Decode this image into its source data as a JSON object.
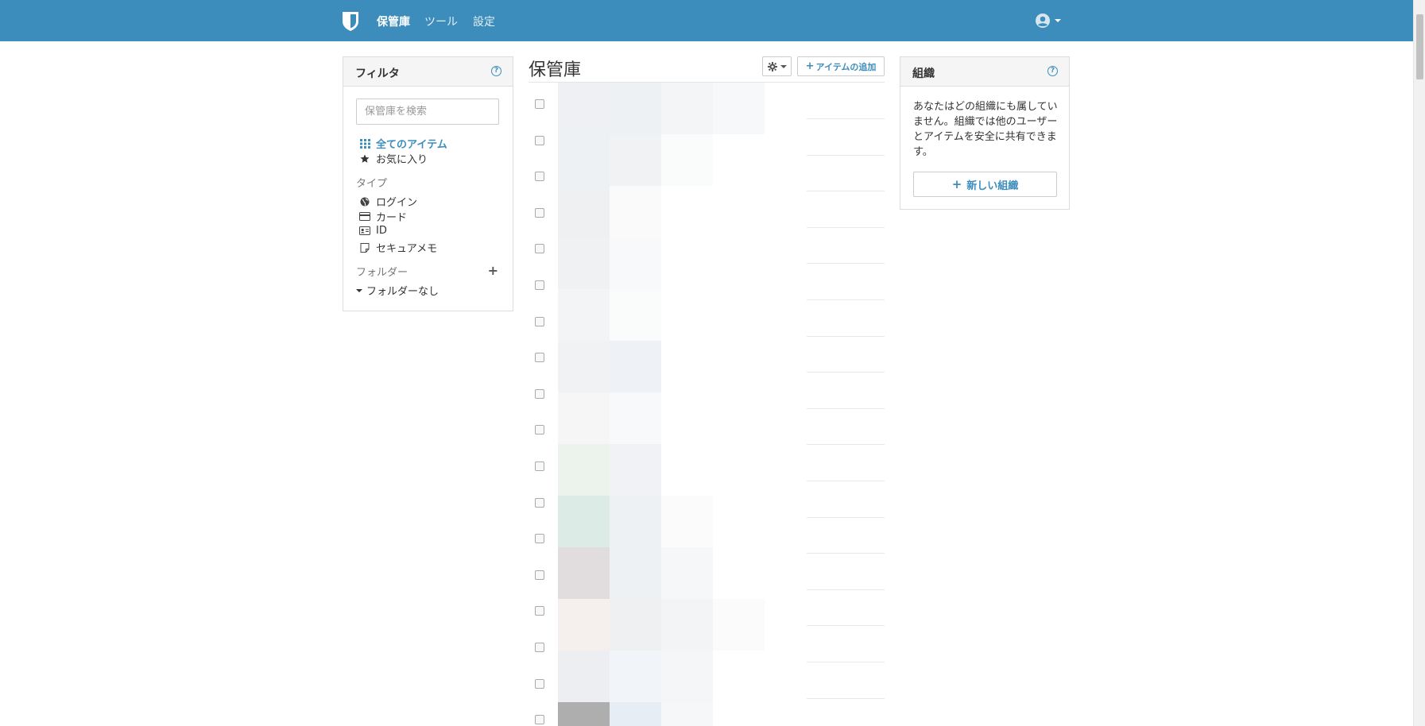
{
  "nav": {
    "logo_icon": "shield-icon",
    "links": [
      {
        "label": "保管庫",
        "active": true
      },
      {
        "label": "ツール",
        "active": false
      },
      {
        "label": "設定",
        "active": false
      }
    ],
    "user_icon": "user-circle-icon",
    "brand_color": "#3c8dbc"
  },
  "filter": {
    "title": "フィルタ",
    "help_label": "?",
    "search_placeholder": "保管庫を検索",
    "all_items": "全てのアイテム",
    "favorites": "お気に入り",
    "types_label": "タイプ",
    "types": [
      {
        "label": "ログイン",
        "icon": "globe-icon"
      },
      {
        "label": "カード",
        "icon": "credit-card-icon"
      },
      {
        "label": "ID",
        "icon": "id-card-icon"
      },
      {
        "label": "セキュアメモ",
        "icon": "note-icon"
      }
    ],
    "folders_label": "フォルダー",
    "add_folder_label": "+",
    "no_folder": "フォルダーなし"
  },
  "vault": {
    "title": "保管庫",
    "add_item_label": "アイテムの追加",
    "add_item_plus": "+"
  },
  "organizations": {
    "title": "組織",
    "help_label": "?",
    "description": "あなたはどの組織にも属していません。組織では他のユーザーとアイテムを安全に共有できます。",
    "new_org_label": "新しい組織",
    "new_org_plus": "+"
  }
}
